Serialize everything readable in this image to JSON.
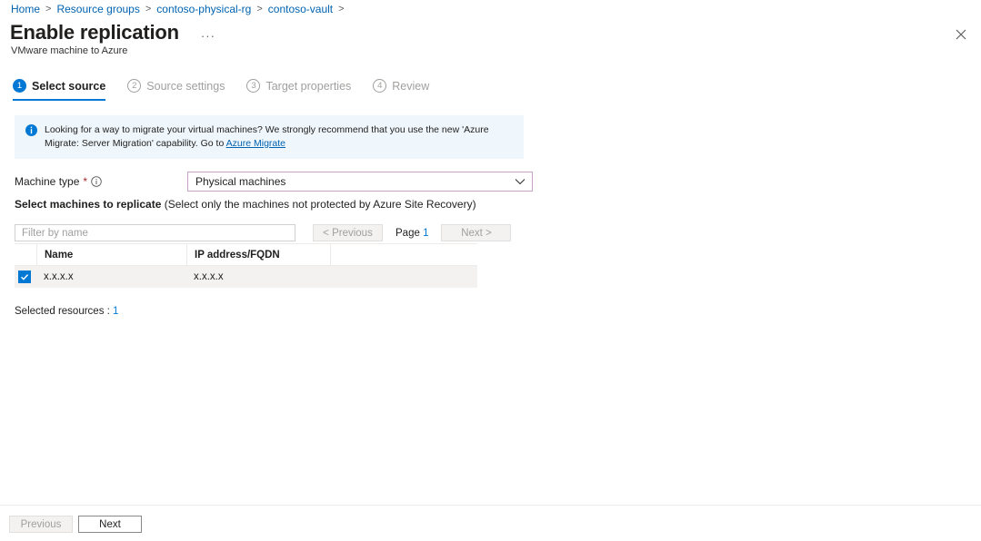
{
  "breadcrumb": {
    "items": [
      {
        "label": "Home"
      },
      {
        "label": "Resource groups"
      },
      {
        "label": "contoso-physical-rg"
      },
      {
        "label": "contoso-vault"
      }
    ],
    "separator": ">"
  },
  "header": {
    "title": "Enable replication",
    "subtitle": "VMware machine to Azure",
    "ellipsis_label": "···",
    "close_label": "Close"
  },
  "tabs": [
    {
      "num": "1",
      "label": "Select source",
      "active": true
    },
    {
      "num": "2",
      "label": "Source settings",
      "active": false
    },
    {
      "num": "3",
      "label": "Target properties",
      "active": false
    },
    {
      "num": "4",
      "label": "Review",
      "active": false
    }
  ],
  "banner": {
    "text_before": "Looking for a way to migrate your virtual machines? We strongly recommend that you use the new 'Azure Migrate: Server Migration' capability. Go to ",
    "link_label": "Azure Migrate"
  },
  "machine_type": {
    "label": "Machine type",
    "required_mark": "*",
    "selected": "Physical machines",
    "options": [
      "Physical machines"
    ]
  },
  "section": {
    "label_bold": "Select machines to replicate",
    "label_rest": " (Select only the machines not protected by Azure Site Recovery)"
  },
  "toolbar": {
    "filter_placeholder": "Filter by name",
    "filter_value": "",
    "previous_label": "< Previous",
    "next_label": "Next >",
    "page_text": "Page ",
    "page_number": "1"
  },
  "table": {
    "columns": [
      "Name",
      "IP address/FQDN"
    ],
    "rows": [
      {
        "checked": true,
        "name": "x.x.x.x",
        "ip": "x.x.x.x"
      }
    ]
  },
  "selected_resources": {
    "label": "Selected resources : ",
    "count": "1"
  },
  "footer": {
    "previous_label": "Previous",
    "next_label": "Next"
  },
  "colors": {
    "accent": "#0078d4",
    "link": "#0063b1",
    "banner_bg": "#eff6fc",
    "required": "#a4262c",
    "select_border": "#c8a2c8",
    "row_bg": "#f3f2f1",
    "disabled_text": "#a19f9d"
  }
}
